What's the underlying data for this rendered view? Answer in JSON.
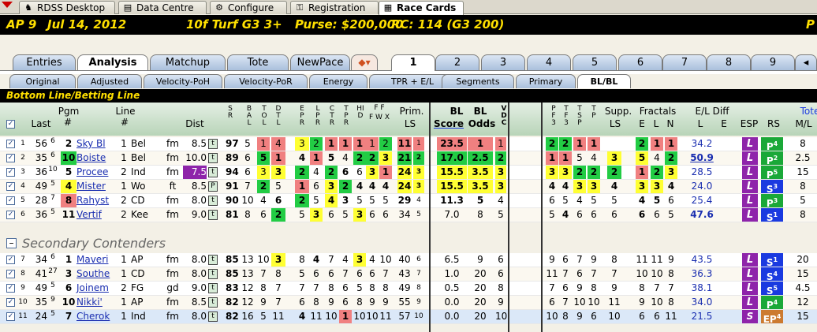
{
  "top_tabs": [
    {
      "label": "RDSS Desktop",
      "icon": "horse-icon"
    },
    {
      "label": "Data Centre",
      "icon": "database-icon"
    },
    {
      "label": "Configure",
      "icon": "gear-icon"
    },
    {
      "label": "Registration",
      "icon": "key-icon"
    },
    {
      "label": "Race Cards",
      "icon": "card-icon"
    }
  ],
  "race_header": {
    "track": "AP 9",
    "date": "Jul 14, 2012",
    "info": "10f Turf G3 3+",
    "purse": "Purse: $200,000",
    "rc": "RC: 114 (G3 200)",
    "tail": "P"
  },
  "main_tabs": [
    "Entries",
    "Analysis",
    "Matchup",
    "Tote",
    "NewPace"
  ],
  "race_number_tabs": [
    "1",
    "2",
    "3",
    "4",
    "5",
    "6",
    "7",
    "8",
    "9"
  ],
  "sub_tabs": [
    "Original",
    "Adjusted",
    "Velocity-PoH",
    "Velocity-PoR",
    "Energy",
    "TPR + E/L",
    "Segments",
    "Primary",
    "BL/BL"
  ],
  "section_title": "Bottom Line/Betting Line",
  "columns": {
    "last": "Last",
    "pgm": "Pgm",
    "pgm_sub": "#",
    "line": "Line",
    "line_sub": "#",
    "dist": "Dist",
    "sr": "SR",
    "bal": "BAL",
    "tol": "TOL",
    "dtl": "DTL",
    "epr": "EPR",
    "lpr": "LPR",
    "ctr": "CTR",
    "tpr": "TPR",
    "hid": "HID",
    "ff": "F F",
    "fwx": "F W X",
    "prim": "Prim.",
    "ls": "LS",
    "bl": "BL",
    "bl2": "BL",
    "score": "Score",
    "odds": "Odds",
    "vdc": "VDC",
    "pf3": "PF3",
    "tf3": "TF3",
    "tsp": "TSP",
    "tp": "TP",
    "supp": "Supp.",
    "supp_ls": "LS",
    "fractals": "Fractals",
    "fe": "E",
    "fl": "L",
    "fn": "N",
    "eldiff": "E/L Diff",
    "el_l": "L",
    "el_e": "E",
    "esp": "ESP",
    "rs": "RS",
    "tote": "Tote",
    "ml": "M/L"
  },
  "secondary_title": "Secondary Contenders",
  "rows": [
    {
      "n": "1",
      "last": "56",
      "lastsup": "6",
      "pgm": "2",
      "horse": "Sky Bl",
      "line": "1",
      "track": "Bel",
      "cond": "fm",
      "dist": "8.5",
      "surf": "t",
      "sr": "97",
      "bal": "5",
      "tol": "1",
      "dtl": "4",
      "epr": "3",
      "lpr": "2",
      "ctr": "1",
      "tpr": "1",
      "hid": "1",
      "ff": "1",
      "fwx": "2",
      "prim": "11",
      "ls": "1",
      "score": "23.5",
      "odds": "1",
      "vdc": "1",
      "pf": "2",
      "tf": "2",
      "ts": "1",
      "tp": "1",
      "supp": "",
      "fe": "2",
      "fl": "1",
      "fn": "1",
      "el": "34.2",
      "esp": "L",
      "rs": "P",
      "rssup": "4",
      "ml": "8"
    },
    {
      "n": "2",
      "last": "35",
      "lastsup": "6",
      "pgm": "10",
      "horse": "Boiste",
      "line": "1",
      "track": "Bel",
      "cond": "fm",
      "dist": "10.0",
      "surf": "t",
      "sr": "89",
      "bal": "6",
      "tol": "5",
      "dtl": "1",
      "epr": "4",
      "lpr": "1",
      "ctr": "5",
      "tpr": "4",
      "hid": "2",
      "ff": "2",
      "fwx": "3",
      "prim": "21",
      "ls": "2",
      "score": "17.0",
      "odds": "2.5",
      "vdc": "2",
      "pf": "1",
      "tf": "1",
      "ts": "5",
      "tp": "4",
      "supp": "3",
      "fe": "5",
      "fl": "4",
      "fn": "2",
      "el": "50.9",
      "esp": "L",
      "rs": "P",
      "rssup": "2",
      "ml": "2.5"
    },
    {
      "n": "3",
      "last": "36",
      "lastsup": "10",
      "pgm": "5",
      "horse": "Procee",
      "line": "2",
      "track": "Ind",
      "cond": "fm",
      "dist": "7.5",
      "surf": "t",
      "sr": "94",
      "bal": "6",
      "tol": "3",
      "dtl": "3",
      "epr": "2",
      "lpr": "4",
      "ctr": "2",
      "tpr": "6",
      "hid": "6",
      "ff": "3",
      "fwx": "1",
      "prim": "24",
      "ls": "3",
      "score": "15.5",
      "odds": "3.5",
      "vdc": "3",
      "pf": "3",
      "tf": "3",
      "ts": "2",
      "tp": "2",
      "supp": "2",
      "fe": "1",
      "fl": "2",
      "fn": "3",
      "el": "28.5",
      "esp": "L",
      "rs": "P",
      "rssup": "5",
      "ml": "15"
    },
    {
      "n": "4",
      "last": "49",
      "lastsup": "5",
      "pgm": "4",
      "horse": "Mister",
      "line": "1",
      "track": "Wo",
      "cond": "ft",
      "dist": "8.5",
      "surf": "P",
      "sr": "91",
      "bal": "7",
      "tol": "2",
      "dtl": "5",
      "epr": "1",
      "lpr": "6",
      "ctr": "3",
      "tpr": "2",
      "hid": "4",
      "ff": "4",
      "fwx": "4",
      "prim": "24",
      "ls": "3",
      "score": "15.5",
      "odds": "3.5",
      "vdc": "3",
      "pf": "4",
      "tf": "4",
      "ts": "3",
      "tp": "3",
      "supp": "4",
      "fe": "3",
      "fl": "3",
      "fn": "4",
      "el": "24.0",
      "esp": "L",
      "rs": "S",
      "rssup": "3",
      "ml": "8"
    },
    {
      "n": "5",
      "last": "28",
      "lastsup": "7",
      "pgm": "8",
      "horse": "Rahyst",
      "line": "2",
      "track": "CD",
      "cond": "fm",
      "dist": "8.0",
      "surf": "t",
      "sr": "90",
      "bal": "10",
      "tol": "4",
      "dtl": "6",
      "epr": "2",
      "lpr": "5",
      "ctr": "4",
      "tpr": "3",
      "hid": "5",
      "ff": "5",
      "fwx": "5",
      "prim": "29",
      "ls": "4",
      "score": "11.3",
      "odds": "5",
      "vdc": "4",
      "pf": "6",
      "tf": "5",
      "ts": "4",
      "tp": "5",
      "supp": "5",
      "fe": "4",
      "fl": "5",
      "fn": "6",
      "el": "25.4",
      "esp": "L",
      "rs": "P",
      "rssup": "3",
      "ml": "5"
    },
    {
      "n": "6",
      "last": "36",
      "lastsup": "5",
      "pgm": "11",
      "horse": "Vertif",
      "line": "2",
      "track": "Kee",
      "cond": "fm",
      "dist": "9.0",
      "surf": "t",
      "sr": "81",
      "bal": "8",
      "tol": "6",
      "dtl": "2",
      "epr": "5",
      "lpr": "3",
      "ctr": "6",
      "tpr": "5",
      "hid": "3",
      "ff": "6",
      "fwx": "6",
      "prim": "34",
      "ls": "5",
      "score": "7.0",
      "odds": "8",
      "vdc": "5",
      "pf": "5",
      "tf": "4",
      "ts": "6",
      "tp": "6",
      "supp": "6",
      "fe": "6",
      "fl": "6",
      "fn": "5",
      "el": "47.6",
      "esp": "L",
      "rs": "S",
      "rssup": "1",
      "ml": "8"
    },
    {
      "n": "7",
      "last": "34",
      "lastsup": "6",
      "pgm": "1",
      "horse": "Maveri",
      "line": "1",
      "track": "AP",
      "cond": "fm",
      "dist": "8.0",
      "surf": "t",
      "sr": "85",
      "bal": "13",
      "tol": "10",
      "dtl": "3",
      "epr": "8",
      "lpr": "4",
      "ctr": "7",
      "tpr": "4",
      "hid": "3",
      "ff": "4",
      "fwx": "10",
      "prim": "40",
      "ls": "6",
      "score": "6.5",
      "odds": "9",
      "vdc": "6",
      "pf": "9",
      "tf": "6",
      "ts": "7",
      "tp": "9",
      "supp": "8",
      "fe": "11",
      "fl": "11",
      "fn": "9",
      "el": "43.5",
      "esp": "L",
      "rs": "S",
      "rssup": "1",
      "ml": "20"
    },
    {
      "n": "8",
      "last": "41",
      "lastsup": "27",
      "pgm": "3",
      "horse": "Southe",
      "line": "1",
      "track": "CD",
      "cond": "fm",
      "dist": "8.0",
      "surf": "t",
      "sr": "85",
      "bal": "13",
      "tol": "7",
      "dtl": "8",
      "epr": "5",
      "lpr": "6",
      "ctr": "6",
      "tpr": "7",
      "hid": "6",
      "ff": "6",
      "fwx": "7",
      "prim": "43",
      "ls": "7",
      "score": "1.0",
      "odds": "20",
      "vdc": "6",
      "pf": "11",
      "tf": "7",
      "ts": "6",
      "tp": "7",
      "supp": "7",
      "fe": "10",
      "fl": "10",
      "fn": "8",
      "el": "36.3",
      "esp": "L",
      "rs": "S",
      "rssup": "4",
      "ml": "15"
    },
    {
      "n": "9",
      "last": "49",
      "lastsup": "5",
      "pgm": "6",
      "horse": "Joinem",
      "line": "2",
      "track": "FG",
      "cond": "gd",
      "dist": "9.0",
      "surf": "t",
      "sr": "83",
      "bal": "12",
      "tol": "8",
      "dtl": "7",
      "epr": "7",
      "lpr": "7",
      "ctr": "8",
      "tpr": "6",
      "hid": "5",
      "ff": "8",
      "fwx": "8",
      "prim": "49",
      "ls": "8",
      "score": "0.5",
      "odds": "20",
      "vdc": "8",
      "pf": "7",
      "tf": "6",
      "ts": "9",
      "tp": "8",
      "supp": "9",
      "fe": "8",
      "fl": "7",
      "fn": "7",
      "el": "38.1",
      "esp": "L",
      "rs": "S",
      "rssup": "5",
      "ml": "4.5"
    },
    {
      "n": "10",
      "last": "35",
      "lastsup": "9",
      "pgm": "10",
      "horse": "Nikki'",
      "line": "1",
      "track": "AP",
      "cond": "fm",
      "dist": "8.5",
      "surf": "t",
      "sr": "82",
      "bal": "12",
      "tol": "9",
      "dtl": "7",
      "epr": "6",
      "lpr": "8",
      "ctr": "9",
      "tpr": "6",
      "hid": "8",
      "ff": "9",
      "fwx": "9",
      "prim": "55",
      "ls": "9",
      "score": "0.0",
      "odds": "20",
      "vdc": "9",
      "pf": "6",
      "tf": "7",
      "ts": "10",
      "tp": "10",
      "supp": "11",
      "fe": "9",
      "fl": "10",
      "fn": "8",
      "el": "34.0",
      "esp": "L",
      "rs": "P",
      "rssup": "4",
      "ml": "12"
    },
    {
      "n": "11",
      "last": "24",
      "lastsup": "5",
      "pgm": "7",
      "horse": "Cherok",
      "line": "1",
      "track": "Ind",
      "cond": "fm",
      "dist": "8.0",
      "surf": "t",
      "sr": "82",
      "bal": "16",
      "tol": "5",
      "dtl": "11",
      "epr": "4",
      "lpr": "11",
      "ctr": "10",
      "tpr": "1",
      "hid": "10",
      "ff": "10",
      "fwx": "11",
      "prim": "57",
      "ls": "10",
      "score": "0.0",
      "odds": "20",
      "vdc": "10",
      "pf": "10",
      "tf": "8",
      "ts": "9",
      "tp": "6",
      "supp": "10",
      "fe": "6",
      "fl": "6",
      "fn": "11",
      "el": "21.5",
      "esp": "S",
      "rs": "EP",
      "rssup": "4",
      "ml": "15"
    }
  ],
  "colors": {
    "green": "#22cc44",
    "yellow": "#ffff33",
    "red": "#f08080",
    "purple": "#8e24aa",
    "blue": "#1a3ae0",
    "orange": "#cc7a30",
    "link": "#1a2eb0"
  }
}
